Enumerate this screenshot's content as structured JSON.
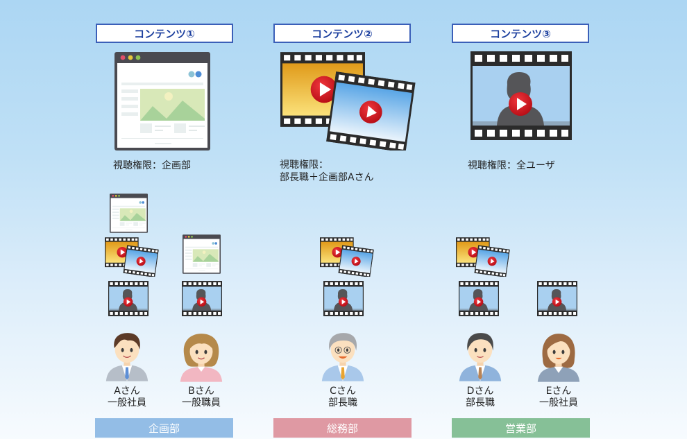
{
  "contents": [
    {
      "title": "コンテンツ①",
      "type": "webpage",
      "permission_lines": [
        "視聴権限：企画部"
      ]
    },
    {
      "title": "コンテンツ②",
      "type": "video-pair",
      "permission_lines": [
        "視聴権限：",
        "部長職＋企画部Aさん"
      ]
    },
    {
      "title": "コンテンツ③",
      "type": "video-person",
      "permission_lines": [
        "視聴権限：全ユーザ"
      ]
    }
  ],
  "departments": [
    {
      "name": "企画部",
      "color": "#93bde6"
    },
    {
      "name": "総務部",
      "color": "#df99a3"
    },
    {
      "name": "営業部",
      "color": "#86c097"
    }
  ],
  "people": [
    {
      "name": "Aさん",
      "role": "一般社員",
      "department": "企画部",
      "visible_contents": [
        "コンテンツ①",
        "コンテンツ②",
        "コンテンツ③"
      ]
    },
    {
      "name": "Bさん",
      "role": "一般職員",
      "department": "企画部",
      "visible_contents": [
        "コンテンツ①",
        "コンテンツ③"
      ]
    },
    {
      "name": "Cさん",
      "role": "部長職",
      "department": "総務部",
      "visible_contents": [
        "コンテンツ②",
        "コンテンツ③"
      ]
    },
    {
      "name": "Dさん",
      "role": "部長職",
      "department": "営業部",
      "visible_contents": [
        "コンテンツ②",
        "コンテンツ③"
      ]
    },
    {
      "name": "Eさん",
      "role": "一般社員",
      "department": "営業部",
      "visible_contents": [
        "コンテンツ③"
      ]
    }
  ],
  "colors": {
    "title_border": "#3b5fb8",
    "title_text": "#1c3f9e",
    "play_button": "#d0121b"
  }
}
